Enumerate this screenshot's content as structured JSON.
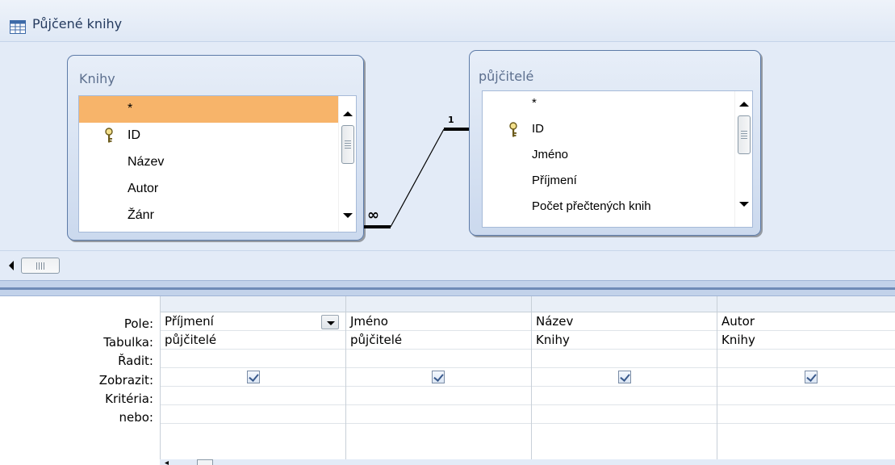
{
  "window": {
    "title": "Půjčené knihy",
    "icon": "query-icon"
  },
  "tables": [
    {
      "title": "Knihy",
      "fields": [
        "*",
        "ID",
        "Název",
        "Autor",
        "Žánr"
      ],
      "selected_field": "*",
      "primary_key": "ID"
    },
    {
      "title": "půjčitelé",
      "fields": [
        "*",
        "ID",
        "Jméno",
        "Příjmení",
        "Počet přečtených knih"
      ],
      "primary_key": "ID"
    }
  ],
  "relationship": {
    "one_label": "1",
    "many_label": "∞"
  },
  "grid": {
    "row_labels": [
      "Pole:",
      "Tabulka:",
      "Řadit:",
      "Zobrazit:",
      "Kritéria:",
      "nebo:"
    ],
    "columns": [
      {
        "field": "Příjmení",
        "table": "půjčitelé",
        "sort": "",
        "show": true,
        "criteria": "",
        "or": ""
      },
      {
        "field": "Jméno",
        "table": "půjčitelé",
        "sort": "",
        "show": true,
        "criteria": "",
        "or": ""
      },
      {
        "field": "Název",
        "table": "Knihy",
        "sort": "",
        "show": true,
        "criteria": "",
        "or": ""
      },
      {
        "field": "Autor",
        "table": "Knihy",
        "sort": "",
        "show": true,
        "criteria": "",
        "or": ""
      }
    ]
  },
  "colors": {
    "selected_row": "#f7b46a",
    "diagram_bg": "#e3ebf7",
    "splitter": "#6f8bb7"
  }
}
